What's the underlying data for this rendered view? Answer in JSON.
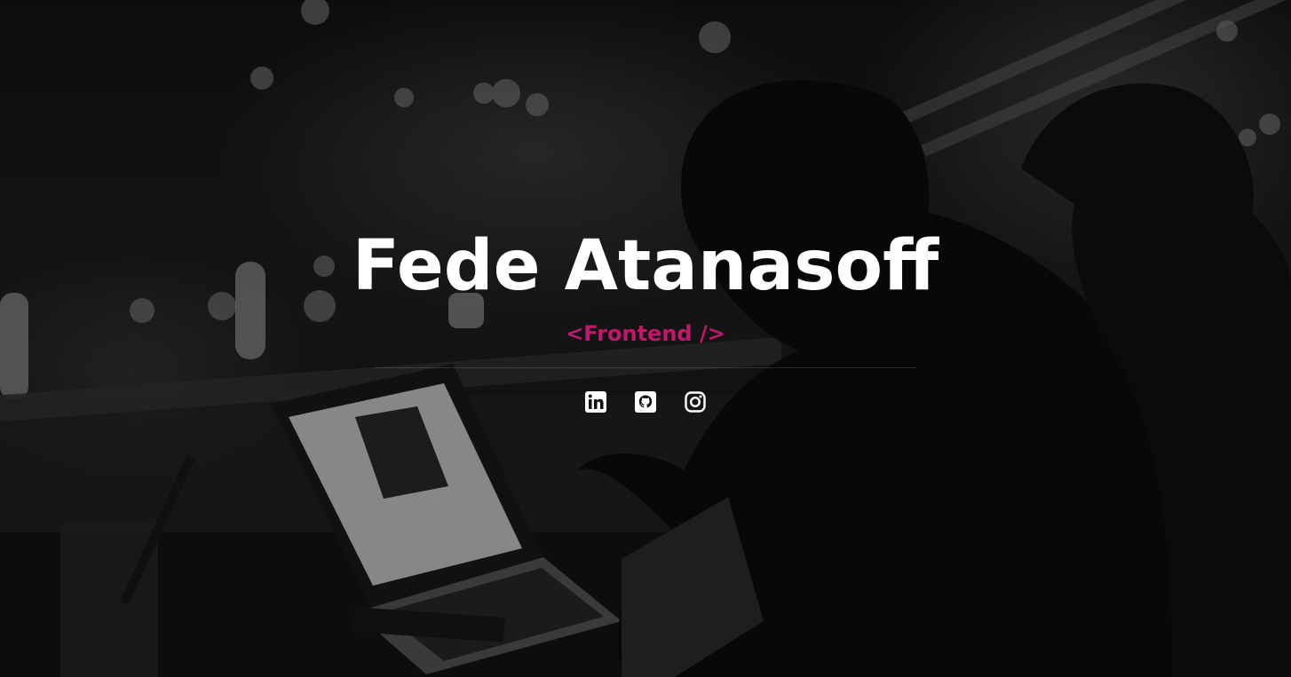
{
  "hero": {
    "name": "Fede Atanasoff",
    "role": "<Frontend />"
  },
  "social": [
    {
      "icon": "linkedin-icon"
    },
    {
      "icon": "github-icon"
    },
    {
      "icon": "instagram-icon"
    }
  ],
  "colors": {
    "accent": "#c0186a",
    "text": "#ffffff",
    "overlay": "#000000"
  }
}
